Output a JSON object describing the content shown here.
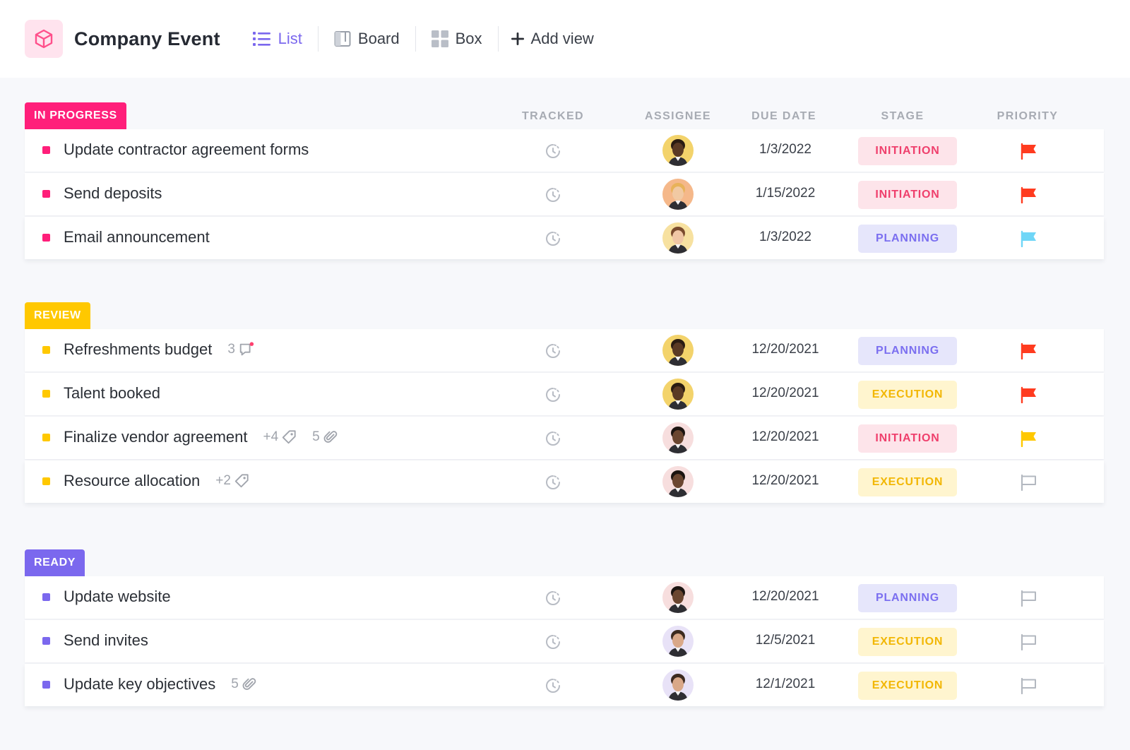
{
  "header": {
    "title": "Company Event",
    "icon": "cube-icon",
    "accent": "#7b68ee",
    "views": [
      {
        "label": "List",
        "icon": "list-icon",
        "active": true
      },
      {
        "label": "Board",
        "icon": "board-icon",
        "active": false
      },
      {
        "label": "Box",
        "icon": "box-grid-icon",
        "active": false
      }
    ],
    "add_view_label": "Add view"
  },
  "columns": {
    "tracked": "TRACKED",
    "assignee": "ASSIGNEE",
    "due_date": "DUE DATE",
    "stage": "STAGE",
    "priority": "PRIORITY"
  },
  "colors": {
    "in_progress": "#ff1f7a",
    "review": "#ffc800",
    "ready": "#7b68ee",
    "flag_urgent": "#ff3b1f",
    "flag_high": "#ffc800",
    "flag_normal": "#6fd6f7"
  },
  "groups": [
    {
      "status": "IN PROGRESS",
      "color": "#ff1f7a",
      "tasks": [
        {
          "name": "Update contractor agreement forms",
          "due": "1/3/2022",
          "stage": "INITIATION",
          "priority": "urgent"
        },
        {
          "name": "Send deposits",
          "due": "1/15/2022",
          "stage": "INITIATION",
          "priority": "urgent"
        },
        {
          "name": "Email announcement",
          "due": "1/3/2022",
          "stage": "PLANNING",
          "priority": "normal"
        }
      ]
    },
    {
      "status": "REVIEW",
      "color": "#ffc800",
      "tasks": [
        {
          "name": "Refreshments budget",
          "comments": "3",
          "due": "12/20/2021",
          "stage": "PLANNING",
          "priority": "urgent"
        },
        {
          "name": "Talent booked",
          "due": "12/20/2021",
          "stage": "EXECUTION",
          "priority": "urgent"
        },
        {
          "name": "Finalize vendor agreement",
          "tags": "+4",
          "attachments": "5",
          "due": "12/20/2021",
          "stage": "INITIATION",
          "priority": "high"
        },
        {
          "name": "Resource allocation",
          "tags": "+2",
          "due": "12/20/2021",
          "stage": "EXECUTION",
          "priority": "none"
        }
      ]
    },
    {
      "status": "READY",
      "color": "#7b68ee",
      "tasks": [
        {
          "name": "Update website",
          "due": "12/20/2021",
          "stage": "PLANNING",
          "priority": "none"
        },
        {
          "name": "Send invites",
          "due": "12/5/2021",
          "stage": "EXECUTION",
          "priority": "none"
        },
        {
          "name": "Update key objectives",
          "attachments": "5",
          "due": "12/1/2021",
          "stage": "EXECUTION",
          "priority": "none"
        }
      ]
    }
  ]
}
